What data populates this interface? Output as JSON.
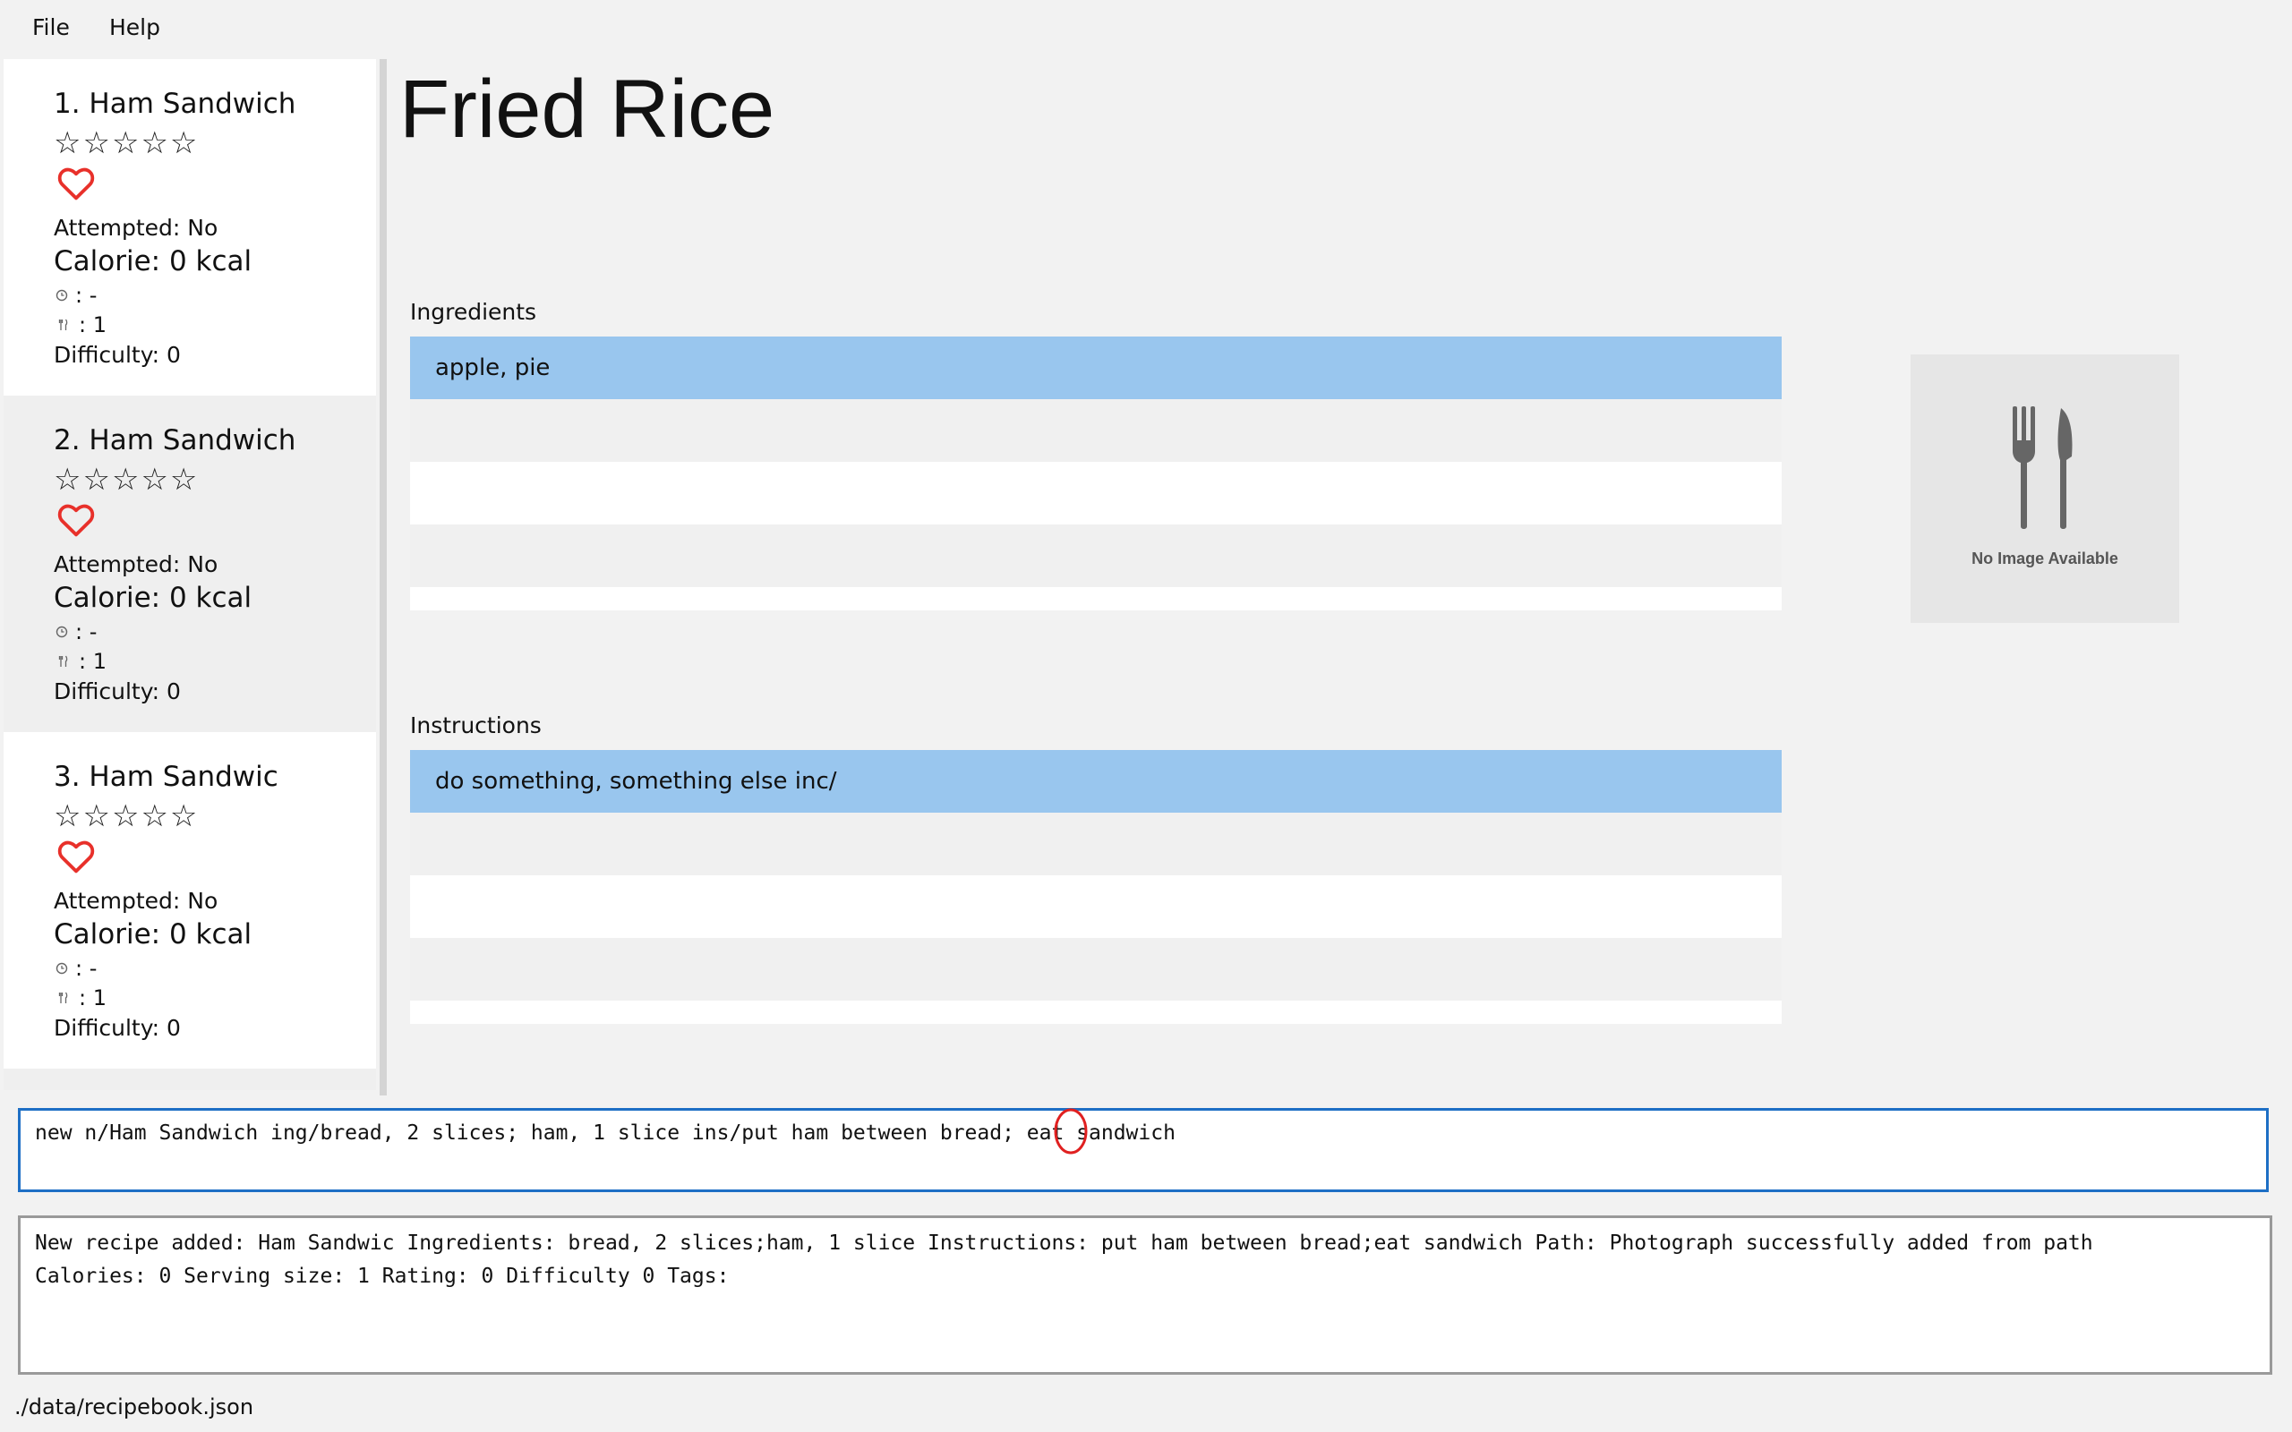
{
  "menu": {
    "file": "File",
    "help": "Help"
  },
  "recipes": [
    {
      "title": "1.  Ham Sandwich",
      "stars": "☆☆☆☆☆",
      "attempted": "Attempted: No",
      "calorie": "Calorie: 0 kcal",
      "time": ": -",
      "serving": ": 1",
      "difficulty": "Difficulty: 0"
    },
    {
      "title": "2.  Ham Sandwich",
      "stars": "☆☆☆☆☆",
      "attempted": "Attempted: No",
      "calorie": "Calorie: 0 kcal",
      "time": ": -",
      "serving": ": 1",
      "difficulty": "Difficulty: 0"
    },
    {
      "title": "3.  Ham Sandwic",
      "stars": "☆☆☆☆☆",
      "attempted": "Attempted: No",
      "calorie": "Calorie: 0 kcal",
      "time": ": -",
      "serving": ": 1",
      "difficulty": "Difficulty: 0"
    }
  ],
  "detail": {
    "title": "Fried Rice",
    "ingredients_label": "Ingredients",
    "ingredients": [
      "apple, pie"
    ],
    "instructions_label": "Instructions",
    "instructions": [
      "do something, something else inc/"
    ],
    "image_caption": "No Image Available"
  },
  "command": {
    "value": "new n/Ham Sandwich ing/bread, 2 slices; ham, 1 slice ins/put ham between bread; eat sandwich"
  },
  "result": {
    "line1": "New recipe added: Ham Sandwic Ingredients: bread, 2 slices;ham, 1 slice Instructions: put ham between bread;eat sandwich Path: Photograph successfully added from path",
    "line2": "Calories: 0 Serving size: 1 Rating: 0 Difficulty 0 Tags:"
  },
  "status": {
    "path": "./data/recipebook.json"
  },
  "colors": {
    "selected_row": "#99c6ee",
    "command_border": "#1e6fc5",
    "heart": "#e8302a",
    "cursor_mark": "#e02020"
  }
}
